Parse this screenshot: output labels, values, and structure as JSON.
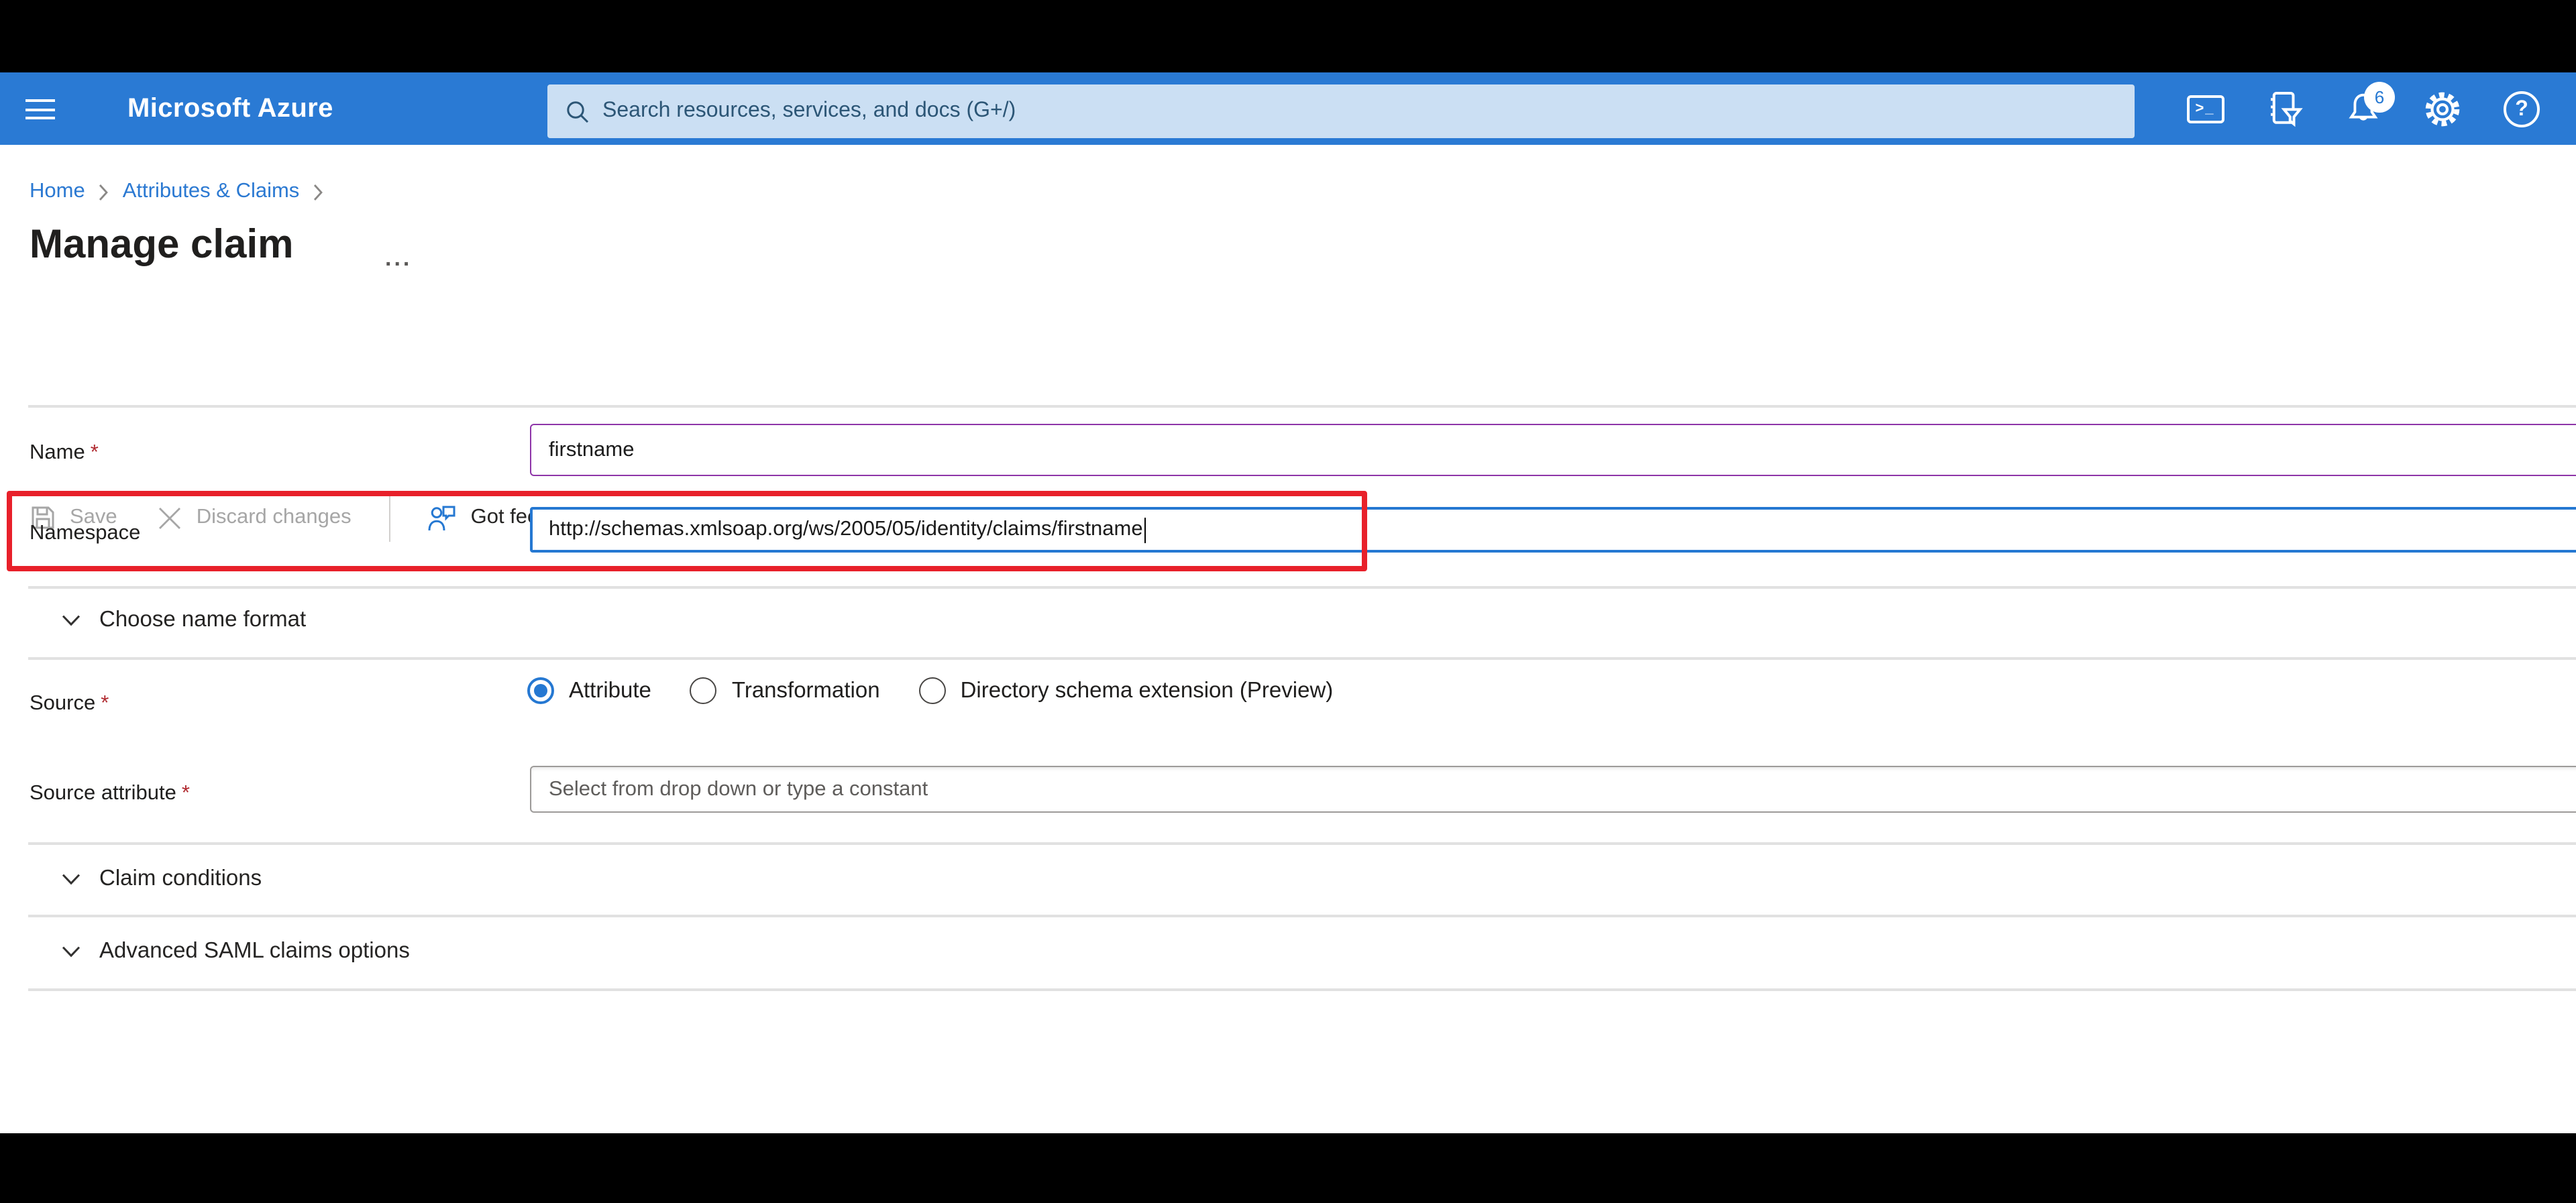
{
  "header": {
    "brand": "Microsoft Azure",
    "search_placeholder": "Search resources, services, and docs (G+/)",
    "notification_count": "6",
    "cloudshell_glyph": ">_",
    "help_glyph": "?",
    "icons": [
      "cloud-shell-icon",
      "directory-filter-icon",
      "notifications-bell-icon",
      "settings-gear-icon",
      "help-icon"
    ]
  },
  "breadcrumb": {
    "items": [
      "Home",
      "Attributes & Claims"
    ]
  },
  "page": {
    "title": "Manage claim",
    "ellipsis": "..."
  },
  "toolbar": {
    "save": "Save",
    "discard": "Discard changes",
    "feedback": "Got feedback?"
  },
  "form": {
    "required_marker": "*",
    "name": {
      "label": "Name",
      "required": true,
      "value": "firstname"
    },
    "namespace": {
      "label": "Namespace",
      "required": false,
      "value": "http://schemas.xmlsoap.org/ws/2005/05/identity/claims/firstname"
    },
    "name_format": {
      "label": "Choose name format"
    },
    "source": {
      "label": "Source",
      "required": true,
      "options": [
        {
          "label": "Attribute",
          "selected": true
        },
        {
          "label": "Transformation",
          "selected": false
        },
        {
          "label": "Directory schema extension (Preview)",
          "selected": false
        }
      ]
    },
    "source_attribute": {
      "label": "Source attribute",
      "required": true,
      "placeholder": "Select from drop down or type a constant"
    },
    "claim_conditions": {
      "label": "Claim conditions"
    },
    "advanced_saml": {
      "label": "Advanced SAML claims options"
    }
  },
  "colors": {
    "header_blue": "#2a7ad4",
    "search_bg": "#cbdff3",
    "link_blue": "#2b79d2",
    "focus_border_blue": "#2578d2",
    "changed_border_purple": "#8e35a8",
    "annotation_red": "#e8202a",
    "required_red": "#b02a30",
    "disabled_gray": "#a6a6a6",
    "letterbox_black": "#000000"
  }
}
